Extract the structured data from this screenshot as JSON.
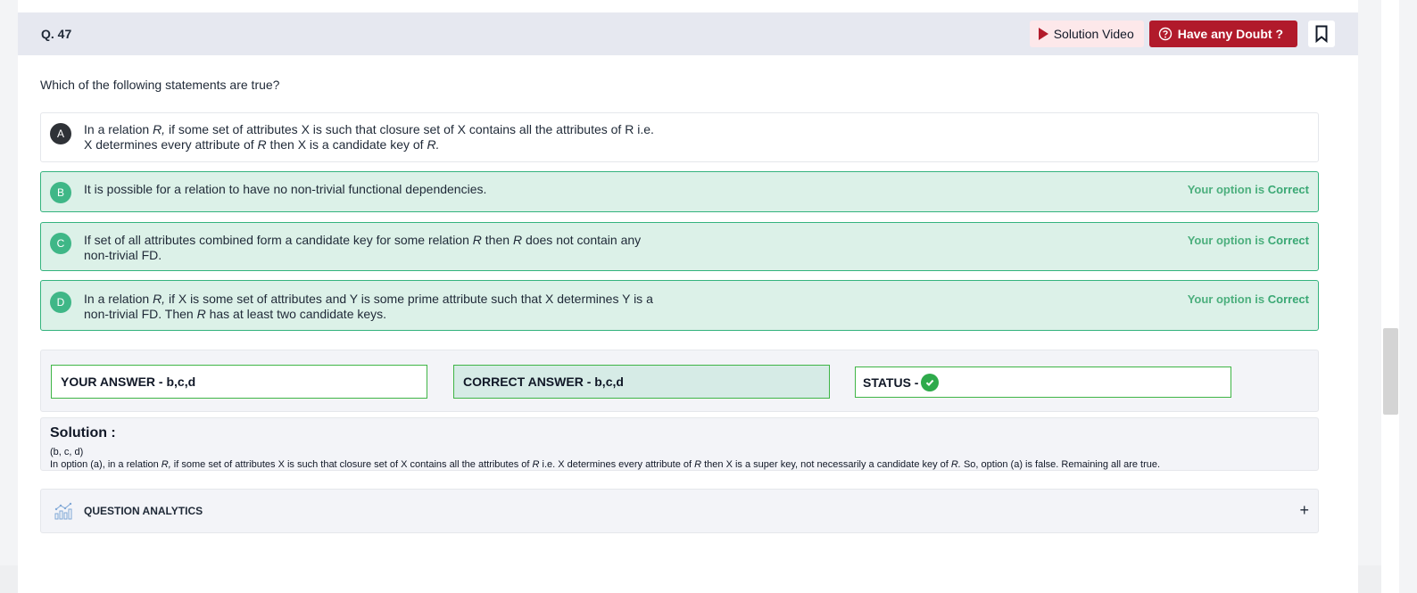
{
  "question": {
    "number": "Q. 47",
    "text": "Which of the following statements are true?"
  },
  "header": {
    "solution_video_label": "Solution Video",
    "doubt_label": "Have any Doubt ?"
  },
  "options": [
    {
      "letter": "A",
      "parts": {
        "p1": "In a relation ",
        "r1": "R,",
        "p2": " if some set of attributes X is such that closure set of X contains all the attributes of R i.e.",
        "p3": "X determines every attribute of ",
        "r2": "R",
        "p4": " then X is a candidate key of ",
        "r3": "R."
      }
    },
    {
      "letter": "B",
      "text": "It is possible for a relation to have no non-trivial functional dependencies.",
      "status_prefix": "Your option is",
      "status_word": "Correct"
    },
    {
      "letter": "C",
      "parts": {
        "p1": "If set of all attributes combined form a candidate key for some relation ",
        "r1": "R",
        "p2": " then ",
        "r2": "R",
        "p3": " does not contain any",
        "p4": "non-trivial FD."
      },
      "status_prefix": "Your option is",
      "status_word": "Correct"
    },
    {
      "letter": "D",
      "parts": {
        "p1": "In a relation ",
        "r1": "R,",
        "p2": " if X is some set of attributes and Y is some prime attribute such that X determines Y is a",
        "p3": "non-trivial FD. Then ",
        "r2": "R",
        "p4": " has at least two candidate keys."
      },
      "status_prefix": "Your option is",
      "status_word": "Correct"
    }
  ],
  "answers": {
    "your_answer": "YOUR ANSWER - b,c,d",
    "correct_answer": "CORRECT ANSWER - b,c,d",
    "status_label": "STATUS -"
  },
  "solution": {
    "title": "Solution :",
    "line1": "(b, c, d)",
    "line2": {
      "p1": "In option (a), in a relation ",
      "r1": "R,",
      "p2": " if some set of attributes X is such that closure set of X contains all the attributes of ",
      "r2": "R",
      "p3": " i.e. X determines every attribute of ",
      "r3": "R",
      "p4": " then X is a super key, not necessarily a candidate key of ",
      "r4": "R.",
      "p5": " So, option (a) is false. Remaining all are true."
    }
  },
  "analytics": {
    "label": "QUESTION ANALYTICS",
    "toggle": "+"
  },
  "colors": {
    "correct_bg": "#dcf1e8",
    "correct_border": "#34b37e",
    "doubt_red": "#b11a2b",
    "header_bg": "#e6e8f0"
  }
}
